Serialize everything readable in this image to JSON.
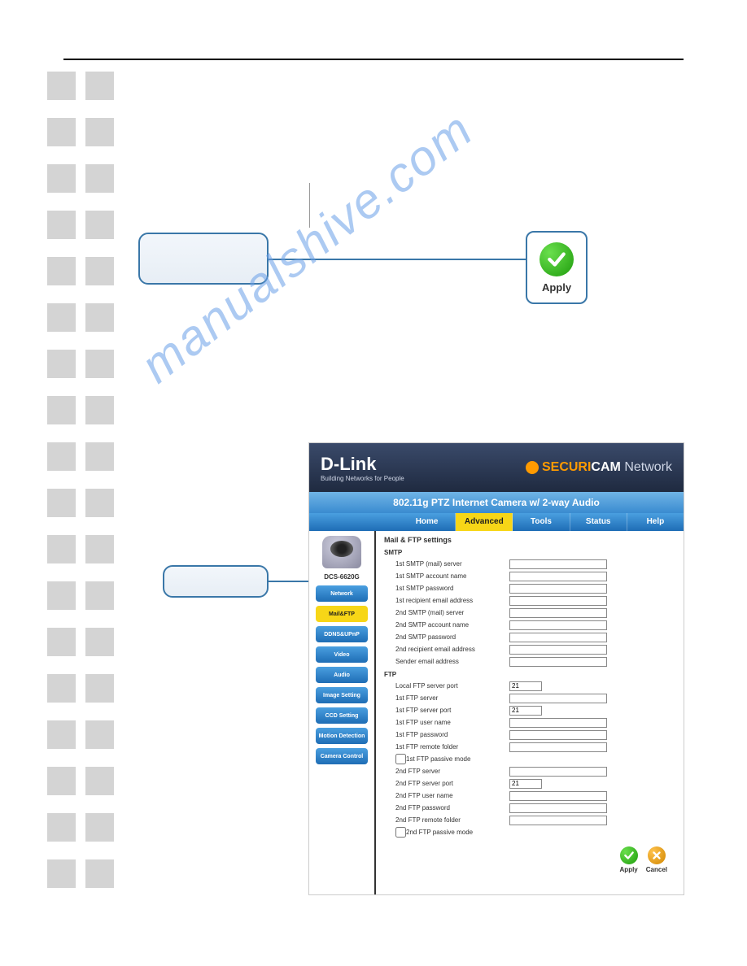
{
  "watermark": "manualshive.com",
  "apply_badge_label": "Apply",
  "ui": {
    "brand": "D-Link",
    "brand_tagline": "Building Networks for People",
    "securicam_prefix": "SECURI",
    "securicam_suffix": "CAM",
    "securicam_network": "Network",
    "subhead": "802.11g PTZ Internet Camera w/ 2-way Audio",
    "tabs": [
      "Home",
      "Advanced",
      "Tools",
      "Status",
      "Help"
    ],
    "active_tab_index": 1,
    "model": "DCS-6620G",
    "side_buttons": [
      "Network",
      "Mail&FTP",
      "DDNS&UPnP",
      "Video",
      "Audio",
      "Image Setting",
      "CCD Setting",
      "Motion Detection",
      "Camera Control"
    ],
    "active_side_index": 1,
    "section_title": "Mail & FTP settings",
    "smtp_title": "SMTP",
    "ftp_title": "FTP",
    "smtp_fields": [
      {
        "label": "1st SMTP (mail) server",
        "value": ""
      },
      {
        "label": "1st SMTP account name",
        "value": ""
      },
      {
        "label": "1st SMTP password",
        "value": ""
      },
      {
        "label": "1st recipient email address",
        "value": ""
      },
      {
        "label": "2nd SMTP (mail) server",
        "value": ""
      },
      {
        "label": "2nd SMTP account name",
        "value": ""
      },
      {
        "label": "2nd SMTP password",
        "value": ""
      },
      {
        "label": "2nd recipient email address",
        "value": ""
      },
      {
        "label": "Sender email address",
        "value": ""
      }
    ],
    "ftp_fields": [
      {
        "label": "Local FTP server port",
        "value": "21",
        "short": true
      },
      {
        "label": "1st FTP server",
        "value": ""
      },
      {
        "label": "1st FTP server port",
        "value": "21",
        "short": true
      },
      {
        "label": "1st FTP user name",
        "value": ""
      },
      {
        "label": "1st FTP password",
        "value": ""
      },
      {
        "label": "1st FTP remote folder",
        "value": ""
      }
    ],
    "ftp_chk1": "1st FTP passive mode",
    "ftp_fields2": [
      {
        "label": "2nd FTP server",
        "value": ""
      },
      {
        "label": "2nd FTP server port",
        "value": "21",
        "short": true
      },
      {
        "label": "2nd FTP user name",
        "value": ""
      },
      {
        "label": "2nd FTP password",
        "value": ""
      },
      {
        "label": "2nd FTP remote folder",
        "value": ""
      }
    ],
    "ftp_chk2": "2nd FTP passive mode",
    "action_apply": "Apply",
    "action_cancel": "Cancel"
  }
}
